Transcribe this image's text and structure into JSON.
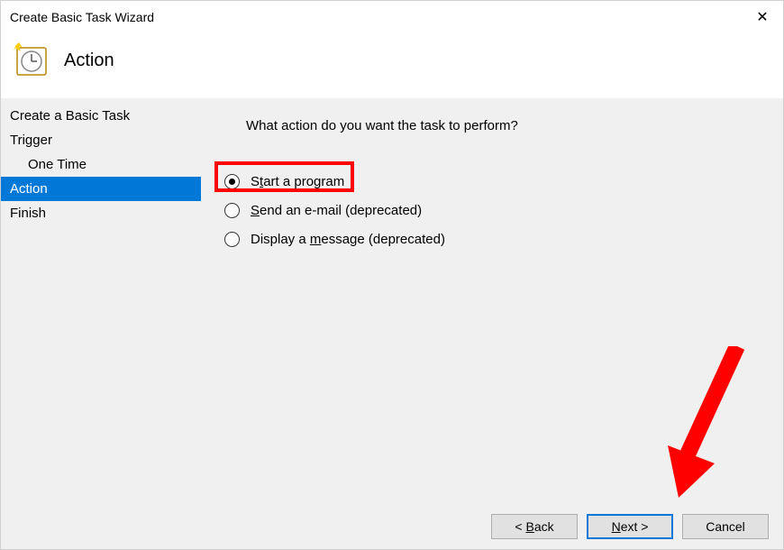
{
  "window": {
    "title": "Create Basic Task Wizard"
  },
  "header": {
    "title": "Action"
  },
  "sidebar": {
    "steps": [
      {
        "label": "Create a Basic Task",
        "indent": false,
        "active": false
      },
      {
        "label": "Trigger",
        "indent": false,
        "active": false
      },
      {
        "label": "One Time",
        "indent": true,
        "active": false
      },
      {
        "label": "Action",
        "indent": false,
        "active": true
      },
      {
        "label": "Finish",
        "indent": false,
        "active": false
      }
    ]
  },
  "main": {
    "prompt": "What action do you want the task to perform?",
    "options": [
      {
        "id": "start-program",
        "label_pre": "S",
        "accel": "t",
        "label_post": "art a program",
        "checked": true
      },
      {
        "id": "send-email",
        "label_pre": "",
        "accel": "S",
        "label_post": "end an e-mail (deprecated)",
        "checked": false
      },
      {
        "id": "display-message",
        "label_pre": "Display a ",
        "accel": "m",
        "label_post": "essage (deprecated)",
        "checked": false
      }
    ]
  },
  "footer": {
    "back_pre": "< ",
    "back_accel": "B",
    "back_post": "ack",
    "next_accel": "N",
    "next_post": "ext >",
    "cancel": "Cancel"
  },
  "annotation": {
    "highlight_option": 0,
    "arrow_points_to": "next-button"
  }
}
